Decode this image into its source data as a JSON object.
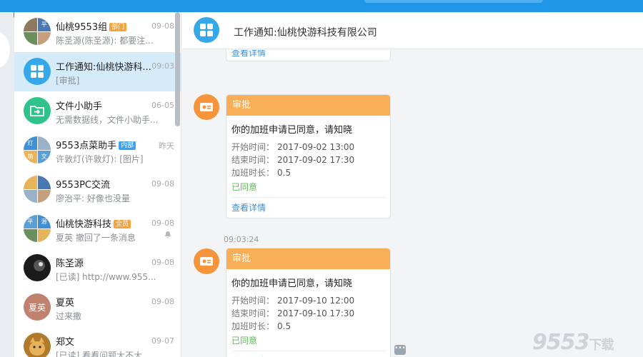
{
  "window": {
    "title": "工作通知:仙桃快游科技有限公司"
  },
  "conversations": [
    {
      "name": "仙桃9553组",
      "tag": "部门",
      "time": "09-08",
      "preview": "陈圣源(陈圣源): 都要注..."
    },
    {
      "name": "工作通知:仙桃快游科...",
      "tag": "",
      "time": "09:03",
      "preview": "[审批]"
    },
    {
      "name": "文件小助手",
      "tag": "",
      "time": "06-05",
      "preview": "无需数据线，文件小助手..."
    },
    {
      "name": "9553点菜助手",
      "tag": "内部",
      "time": "昨天",
      "preview": "许敦灯(许敦灯): [图片]"
    },
    {
      "name": "9553PC交流",
      "tag": "",
      "time": "09-08",
      "preview": "廖治平: 好像也没量"
    },
    {
      "name": "仙桃快游科技",
      "tag": "全员",
      "time": "09-08",
      "preview": "夏英 撤回了一条消息"
    },
    {
      "name": "陈圣源",
      "tag": "",
      "time": "09-08",
      "preview": "[已读] http://www.955..."
    },
    {
      "name": "夏英",
      "tag": "",
      "time": "09-08",
      "preview": "过来撒"
    },
    {
      "name": "郑文",
      "tag": "",
      "time": "09-07",
      "preview": "[已读] 看看问题大不大"
    }
  ],
  "avatars": {
    "group1": [
      "",
      "平",
      "",
      ""
    ],
    "group2": [
      "灯",
      "",
      "萌",
      "文"
    ],
    "group3": [
      "平",
      "源",
      "",
      ""
    ],
    "xiaying": "夏英"
  },
  "messages": {
    "partial_link": "查看详情",
    "card1": {
      "header": "审批",
      "title": "你的加班申请已同意，请知晓",
      "start_label": "开始时间：",
      "start_value": "2017-09-02 13:00",
      "end_label": "结束时间：",
      "end_value": "2017-09-02 17:30",
      "duration_label": "加班时长：",
      "duration_value": "0.5",
      "status": "已同意",
      "link": "查看详情"
    },
    "timestamp2": "09:03:24",
    "card2": {
      "header": "审批",
      "title": "你的加班申请已同意，请知晓",
      "start_label": "开始时间：",
      "start_value": "2017-09-10 12:00",
      "end_label": "结束时间：",
      "end_value": "2017-09-10 17:30",
      "duration_label": "加班时长：",
      "duration_value": "0.5",
      "status": "已同意",
      "link": "查看详情"
    }
  },
  "watermark": {
    "main": "9553",
    "suffix": "下载"
  },
  "colors": {
    "accent": "#1f95e6",
    "card_header": "#f8ad57",
    "approved": "#62b85a",
    "link": "#3a8fd6"
  }
}
